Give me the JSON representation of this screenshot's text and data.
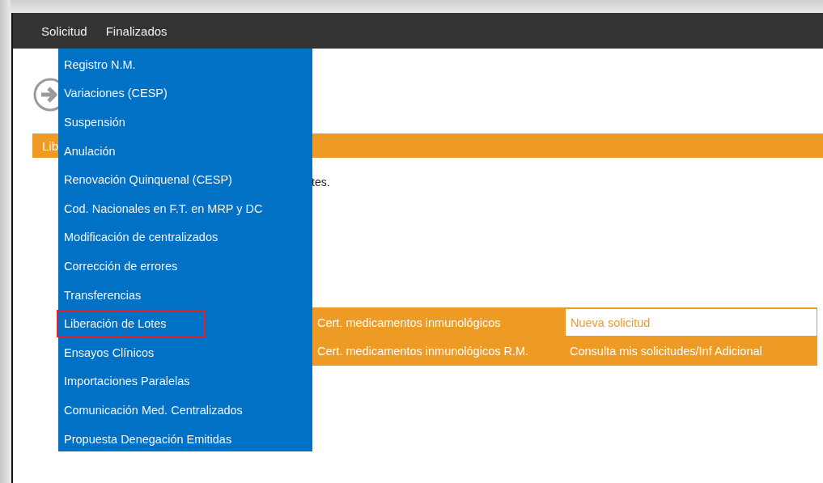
{
  "menu_bar": [
    {
      "label": "Solicitud"
    },
    {
      "label": "Finalizados"
    }
  ],
  "page": {
    "section_header": "Lib",
    "description": "tes."
  },
  "dropdown": [
    {
      "label": "Registro N.M.",
      "selected": false
    },
    {
      "label": "Variaciones (CESP)",
      "selected": false
    },
    {
      "label": "Suspensión",
      "selected": false
    },
    {
      "label": "Anulación",
      "selected": false
    },
    {
      "label": "Renovación Quinquenal (CESP)",
      "selected": false
    },
    {
      "label": "Cod. Nacionales en F.T. en MRP y DC",
      "selected": false
    },
    {
      "label": "Modificación de centralizados",
      "selected": false
    },
    {
      "label": "Corrección de errores",
      "selected": false
    },
    {
      "label": "Transferencias",
      "selected": false
    },
    {
      "label": "Liberación de Lotes",
      "selected": true
    },
    {
      "label": "Ensayos Clínicos",
      "selected": false
    },
    {
      "label": "Importaciones Paralelas",
      "selected": false
    },
    {
      "label": "Comunicación Med. Centralizados",
      "selected": false
    },
    {
      "label": "Propuesta Denegación Emitidas",
      "selected": false
    }
  ],
  "submenu": [
    {
      "label": "Cert. medicamentos inmunológicos"
    },
    {
      "label": "Cert. medicamentos inmunológicos R.M."
    }
  ],
  "actions": [
    {
      "label": "Nueva solicitud",
      "selected": true
    },
    {
      "label": "Consulta mis solicitudes/Inf Adicional",
      "selected": false
    }
  ]
}
